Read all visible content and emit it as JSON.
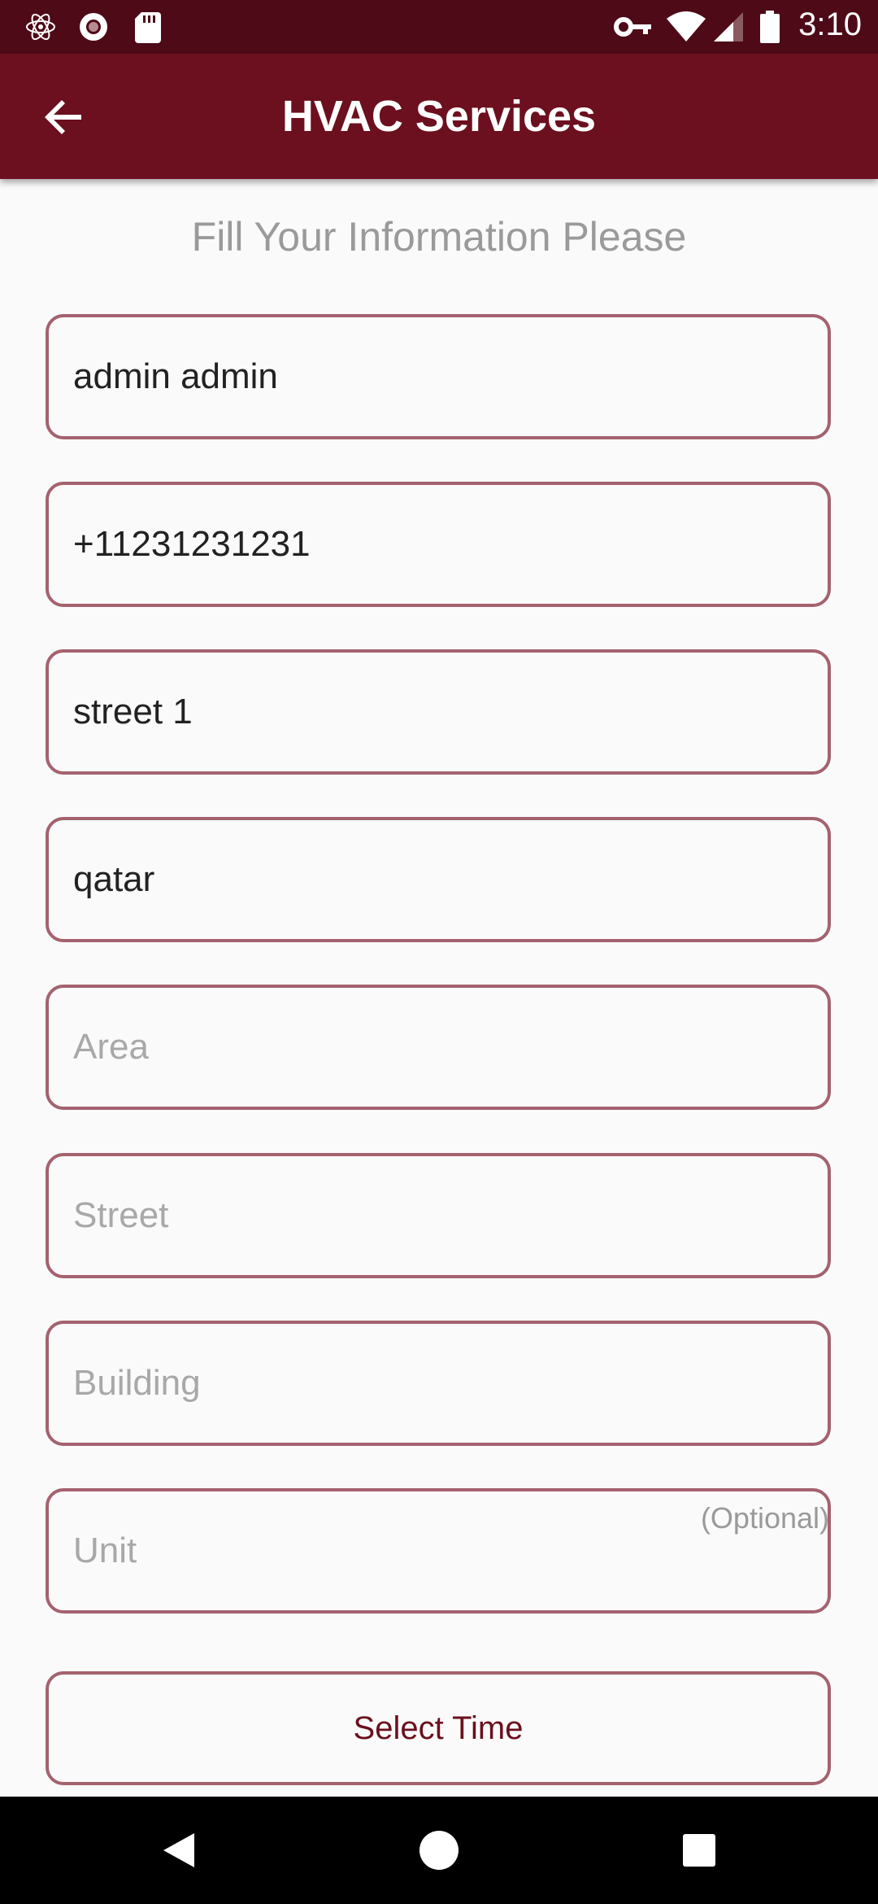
{
  "status_bar": {
    "time": "3:10",
    "left_icons": [
      "react-icon",
      "record-icon",
      "sd-card-icon"
    ],
    "right_icons": [
      "vpn-key-icon",
      "wifi-icon",
      "signal-icon",
      "battery-icon"
    ]
  },
  "app_bar": {
    "title": "HVAC Services",
    "back_icon": "arrow-back-icon",
    "background": "#6c0f1e"
  },
  "form": {
    "heading": "Fill Your Information Please",
    "fields": [
      {
        "value": "admin admin",
        "placeholder": ""
      },
      {
        "value": "+11231231231",
        "placeholder": ""
      },
      {
        "value": "street 1",
        "placeholder": ""
      },
      {
        "value": "qatar",
        "placeholder": ""
      },
      {
        "value": "",
        "placeholder": "Area"
      },
      {
        "value": "",
        "placeholder": "Street"
      },
      {
        "value": "",
        "placeholder": "Building"
      },
      {
        "value": "",
        "placeholder": "Unit",
        "hint": "(Optional)"
      }
    ],
    "select_time_label": "Select Time",
    "border_color": "#a4626f"
  },
  "nav_bar": {
    "buttons": [
      "back-triangle-icon",
      "home-circle-icon",
      "recents-square-icon"
    ]
  }
}
